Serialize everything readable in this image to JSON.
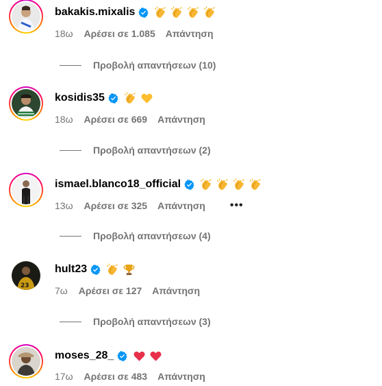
{
  "comments": [
    {
      "username": "bakakis.mixalis",
      "verified": true,
      "emojis": [
        "clapping-hands",
        "clapping-hands",
        "clapping-hands",
        "clapping-hands"
      ],
      "time": "18ω",
      "likes": "Αρέσει σε 1.085",
      "reply": "Απάντηση",
      "view_replies": "Προβολή απαντήσεων (10)",
      "story_ring": true
    },
    {
      "username": "kosidis35",
      "verified": true,
      "emojis": [
        "clapping-hands",
        "yellow-heart"
      ],
      "time": "18ω",
      "likes": "Αρέσει σε 669",
      "reply": "Απάντηση",
      "view_replies": "Προβολή απαντήσεων (2)",
      "story_ring": true
    },
    {
      "username": "ismael.blanco18_official",
      "verified": true,
      "emojis": [
        "clapping-hands",
        "clapping-hands",
        "clapping-hands",
        "clapping-hands"
      ],
      "time": "13ω",
      "likes": "Αρέσει σε 325",
      "reply": "Απάντηση",
      "more": "•••",
      "view_replies": "Προβολή απαντήσεων (4)",
      "story_ring": true
    },
    {
      "username": "hult23",
      "verified": true,
      "emojis": [
        "clapping-hands",
        "trophy"
      ],
      "time": "7ω",
      "likes": "Αρέσει σε 127",
      "reply": "Απάντηση",
      "view_replies": "Προβολή απαντήσεων (3)",
      "story_ring": false
    },
    {
      "username": "moses_28_",
      "verified": true,
      "emojis": [
        "red-heart",
        "red-heart"
      ],
      "time": "17ω",
      "likes": "Αρέσει σε 483",
      "reply": "Απάντηση",
      "story_ring": true
    }
  ],
  "colors": {
    "verified_blue": "#0095f6",
    "meta_gray": "#737373"
  }
}
